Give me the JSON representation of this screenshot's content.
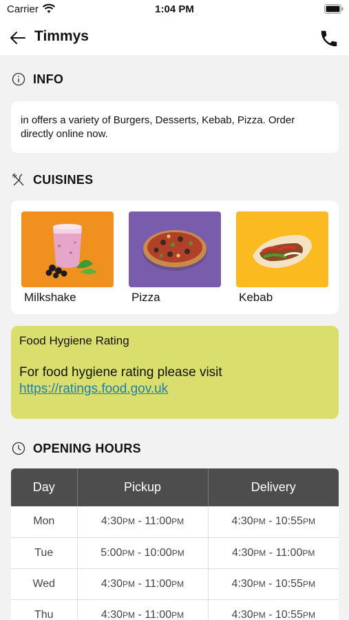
{
  "status_bar": {
    "carrier": "Carrier",
    "time": "1:04 PM"
  },
  "nav": {
    "title": "Timmys"
  },
  "info": {
    "heading": "INFO",
    "description": "in  offers a variety of Burgers, Desserts, Kebab, Pizza. Order directly online now."
  },
  "cuisines": {
    "heading": "CUISINES",
    "items": [
      {
        "label": "Milkshake",
        "color": "#f0901e"
      },
      {
        "label": "Pizza",
        "color": "#7a5cad"
      },
      {
        "label": "Kebab",
        "color": "#fbbb20"
      }
    ]
  },
  "hygiene": {
    "title": "Food Hygiene Rating",
    "text": "For food hygiene rating please visit",
    "link": "https://ratings.food.gov.uk",
    "color": "#d9de6c"
  },
  "opening_hours": {
    "heading": "OPENING HOURS",
    "columns": [
      "Day",
      "Pickup",
      "Delivery"
    ],
    "rows": [
      {
        "day": "Mon",
        "pickup_start": "4:30",
        "pickup_start_ampm": "PM",
        "pickup_end": "11:00",
        "pickup_end_ampm": "PM",
        "delivery_start": "4:30",
        "delivery_start_ampm": "PM",
        "delivery_end": "10:55",
        "delivery_end_ampm": "PM"
      },
      {
        "day": "Tue",
        "pickup_start": "5:00",
        "pickup_start_ampm": "PM",
        "pickup_end": "10:00",
        "pickup_end_ampm": "PM",
        "delivery_start": "4:30",
        "delivery_start_ampm": "PM",
        "delivery_end": "11:00",
        "delivery_end_ampm": "PM"
      },
      {
        "day": "Wed",
        "pickup_start": "4:30",
        "pickup_start_ampm": "PM",
        "pickup_end": "11:00",
        "pickup_end_ampm": "PM",
        "delivery_start": "4:30",
        "delivery_start_ampm": "PM",
        "delivery_end": "10:55",
        "delivery_end_ampm": "PM"
      },
      {
        "day": "Thu",
        "pickup_start": "4:30",
        "pickup_start_ampm": "PM",
        "pickup_end": "11:00",
        "pickup_end_ampm": "PM",
        "delivery_start": "4:30",
        "delivery_start_ampm": "PM",
        "delivery_end": "10:55",
        "delivery_end_ampm": "PM"
      }
    ]
  }
}
